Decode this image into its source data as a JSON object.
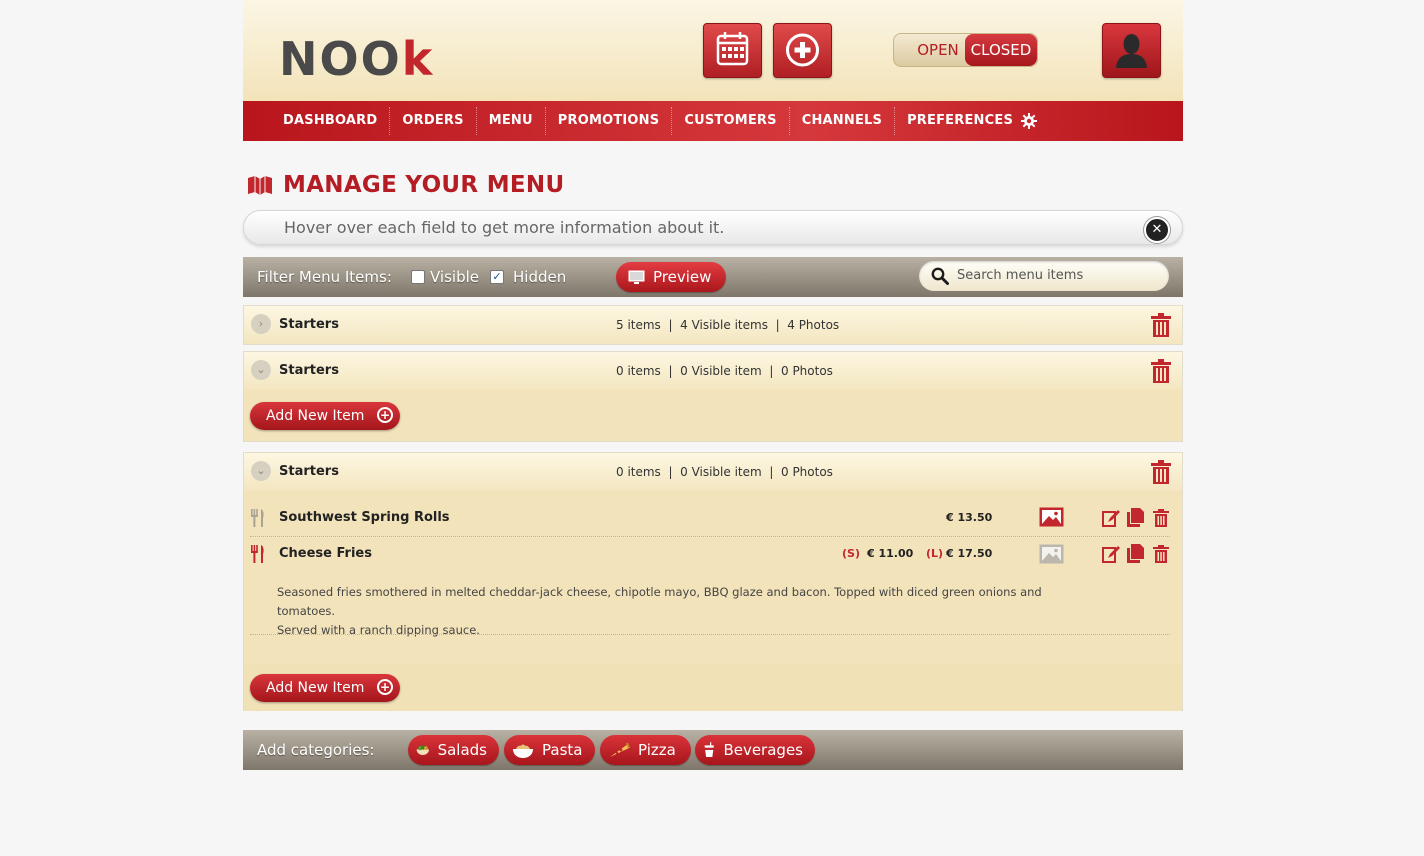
{
  "logo": {
    "text_main": "NOO",
    "text_accent": "k"
  },
  "header": {
    "status_open": "OPEN",
    "status_closed": "CLOSED"
  },
  "nav": {
    "items": [
      "DASHBOARD",
      "ORDERS",
      "MENU",
      "PROMOTIONS",
      "CUSTOMERS",
      "CHANNELS",
      "PREFERENCES"
    ]
  },
  "page": {
    "title": "MANAGE YOUR MENU",
    "hint": "Hover over each field to get more information about it."
  },
  "filter": {
    "label": "Filter Menu Items:",
    "visible_label": "Visible",
    "visible_checked": false,
    "hidden_label": "Hidden",
    "hidden_checked": true,
    "preview_label": "Preview",
    "search_placeholder": "Search menu items"
  },
  "categories": [
    {
      "name": "Starters",
      "stats": "5 items  |  4 Visible items  |  4 Photos",
      "expanded": false
    },
    {
      "name": "Starters",
      "stats": "0 items  |  0 Visible item  |  0 Photos",
      "expanded": true,
      "add_label": "Add New Item"
    },
    {
      "name": "Starters",
      "stats": "0 items  |  0 Visible item  |  0 Photos",
      "expanded": true,
      "add_label": "Add New Item",
      "items": [
        {
          "name": "Southwest Spring Rolls",
          "price": "€ 13.50",
          "has_photo": true
        },
        {
          "name": "Cheese Fries",
          "size_s": "(S)",
          "price_s": "€ 11.00",
          "size_l": "(L)",
          "price_l": "€ 17.50",
          "has_photo": false,
          "description_line1": "Seasoned fries smothered in melted cheddar-jack cheese, chipotle mayo, BBQ glaze and bacon. Topped with diced green onions and tomatoes.",
          "description_line2": "Served with a ranch dipping sauce."
        }
      ]
    }
  ],
  "add_categories": {
    "label": "Add categories:",
    "items": [
      "Salads",
      "Pasta",
      "Pizza",
      "Beverages"
    ]
  },
  "colors": {
    "accent": "#c1272d",
    "nav": "#c6262c",
    "cream": "#f2e3bb"
  }
}
